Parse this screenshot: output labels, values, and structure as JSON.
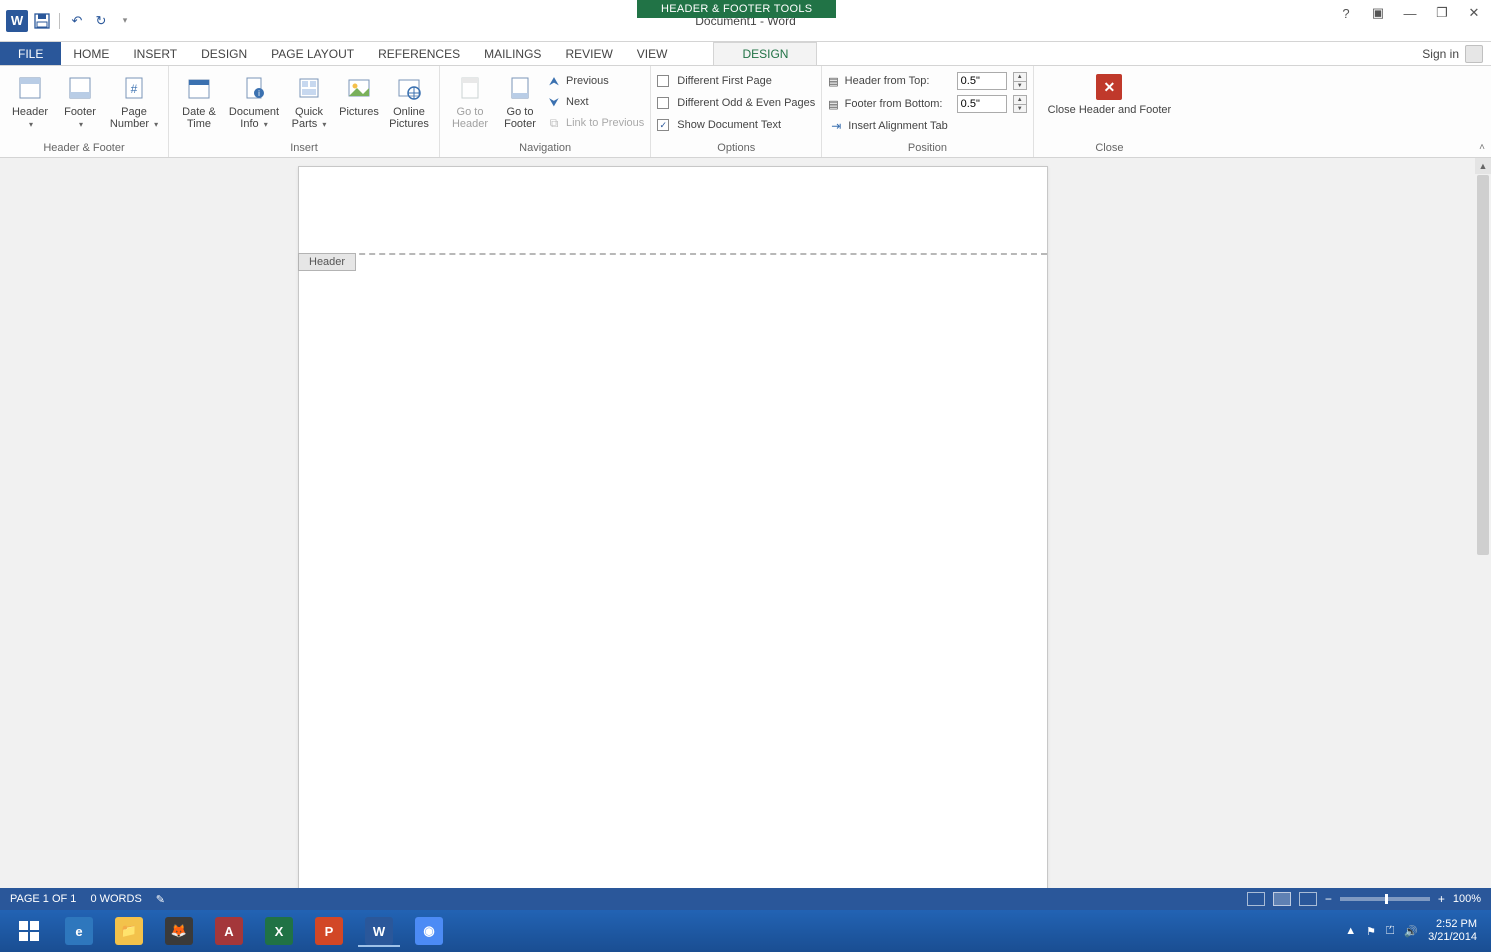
{
  "title": "Document1 - Word",
  "context_tool_label": "HEADER & FOOTER TOOLS",
  "window_buttons": {
    "help": "?",
    "ribbon_opts": "▣",
    "minimize": "—",
    "restore": "❐",
    "close": "✕"
  },
  "signin_label": "Sign in",
  "qat": {
    "undo_tip": "↶",
    "redo_tip": "↻",
    "save_tip": "💾"
  },
  "tabs": {
    "file": "FILE",
    "home": "HOME",
    "insert": "INSERT",
    "design": "DESIGN",
    "page_layout": "PAGE LAYOUT",
    "references": "REFERENCES",
    "mailings": "MAILINGS",
    "review": "REVIEW",
    "view": "VIEW",
    "ctx_design": "DESIGN"
  },
  "ribbon": {
    "hf": {
      "group": "Header & Footer",
      "header": "Header",
      "footer": "Footer",
      "page_number": "Page Number"
    },
    "insert": {
      "group": "Insert",
      "date_time": "Date & Time",
      "doc_info": "Document Info",
      "quick_parts": "Quick Parts",
      "pictures": "Pictures",
      "online_pictures": "Online Pictures"
    },
    "nav": {
      "group": "Navigation",
      "goto_header": "Go to Header",
      "goto_footer": "Go to Footer",
      "previous": "Previous",
      "next": "Next",
      "link": "Link to Previous"
    },
    "options": {
      "group": "Options",
      "diff_first": "Different First Page",
      "diff_odd_even": "Different Odd & Even Pages",
      "show_doc": "Show Document Text",
      "show_doc_checked": true
    },
    "position": {
      "group": "Position",
      "header_from_top": "Header from Top:",
      "header_val": "0.5\"",
      "footer_from_bottom": "Footer from Bottom:",
      "footer_val": "0.5\"",
      "align_tab": "Insert Alignment Tab"
    },
    "close": {
      "group": "Close",
      "label": "Close Header and Footer"
    }
  },
  "document": {
    "header_tab_label": "Header"
  },
  "statusbar": {
    "page": "PAGE 1 OF 1",
    "words": "0 WORDS",
    "zoom": "100%"
  },
  "taskbar": {
    "apps": [
      {
        "name": "start",
        "bg": "#ffffff00",
        "glyph": "⊞"
      },
      {
        "name": "ie",
        "bg": "#2e77bd",
        "glyph": "e"
      },
      {
        "name": "explorer",
        "bg": "#f3c24b",
        "glyph": "📁"
      },
      {
        "name": "firefox",
        "bg": "#3a3a3a",
        "glyph": "🦊"
      },
      {
        "name": "access",
        "bg": "#a4373a",
        "glyph": "A"
      },
      {
        "name": "excel",
        "bg": "#207245",
        "glyph": "X"
      },
      {
        "name": "powerpoint",
        "bg": "#d24726",
        "glyph": "P"
      },
      {
        "name": "word",
        "bg": "#2a579a",
        "glyph": "W"
      },
      {
        "name": "chrome",
        "bg": "#4c8bf5",
        "glyph": "◉"
      }
    ],
    "time": "2:52 PM",
    "date": "3/21/2014"
  }
}
